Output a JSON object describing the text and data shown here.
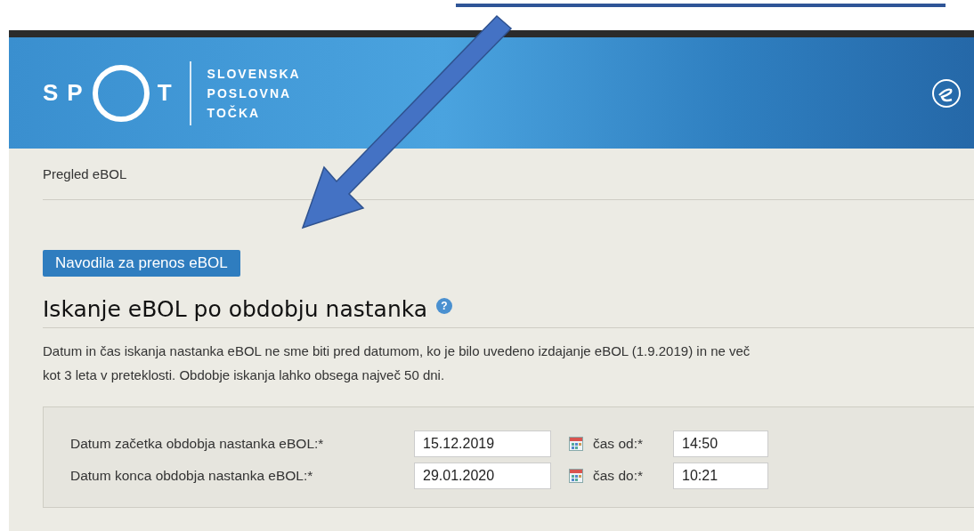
{
  "header": {
    "logo_letters": [
      "S",
      "P",
      "T"
    ],
    "logo_words": [
      "SLOVENSKA",
      "POSLOVNA",
      "TOČKA"
    ]
  },
  "breadcrumb": "Pregled eBOL",
  "instructions_button": "Navodila za prenos eBOL",
  "heading": "Iskanje eBOL po obdobju nastanka",
  "help_glyph": "?",
  "description_lines": [
    "Datum in čas iskanja nastanka eBOL ne sme biti pred datumom, ko je bilo uvedeno izdajanje eBOL (1.9.2019) in ne več",
    "kot 3 leta v preteklosti. Obdobje iskanja lahko obsega največ 50 dni."
  ],
  "form_rows": [
    {
      "label": "Datum začetka obdobja nastanka eBOL:*",
      "date": "15.12.2019",
      "time_label": "čas od:*",
      "time": "14:50"
    },
    {
      "label": "Datum konca obdobja nastanka eBOL:*",
      "date": "29.01.2020",
      "time_label": "čas do:*",
      "time": "10:21"
    }
  ]
}
